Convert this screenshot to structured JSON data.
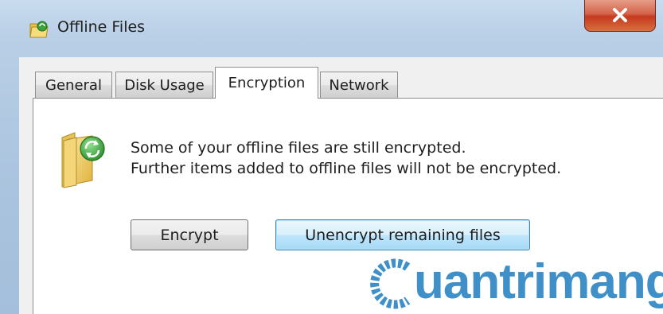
{
  "window": {
    "title": "Offline Files",
    "app_icon": "offline-files-folder-icon",
    "close_icon": "close-icon"
  },
  "tabs": [
    {
      "label": "General",
      "active": false
    },
    {
      "label": "Disk Usage",
      "active": false
    },
    {
      "label": "Encryption",
      "active": true
    },
    {
      "label": "Network",
      "active": false
    }
  ],
  "encryption": {
    "icon": "sync-folder-icon",
    "message_line1": "Some of your offline files are still encrypted.",
    "message_line2": "Further items added to offline files will not be encrypted.",
    "encrypt_label": "Encrypt",
    "unencrypt_label": "Unencrypt remaining files"
  },
  "watermark": {
    "text": "uantrimang"
  },
  "colors": {
    "close_button": "#c4391f",
    "tab_border": "#8e8f8f",
    "default_button_border": "#3c7fb1",
    "watermark": "#3f8fc8",
    "sync_badge": "#3aa33a"
  }
}
